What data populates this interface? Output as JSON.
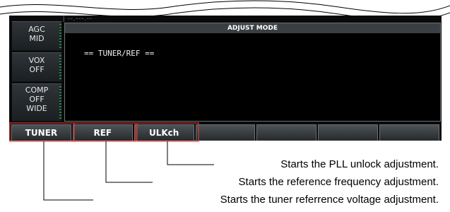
{
  "side_buttons": [
    {
      "lines": [
        "AGC",
        "MID"
      ]
    },
    {
      "lines": [
        "VOX",
        "OFF"
      ]
    },
    {
      "lines": [
        "COMP",
        "OFF",
        "WIDE"
      ]
    }
  ],
  "top_strip": "| --.---.--",
  "adjust": {
    "title": "ADJUST MODE",
    "line": "== TUNER/REF =="
  },
  "softkeys": [
    "TUNER",
    "REF",
    "ULKch",
    "",
    "",
    "",
    ""
  ],
  "annotations": [
    "Starts the PLL unlock adjustment.",
    "Starts the reference frequency adjustment.",
    "Starts the tuner referrence voltage adjustment."
  ],
  "colors": {
    "callout_red": "#e03a2f",
    "screen_bg": "#0a0a0a"
  }
}
